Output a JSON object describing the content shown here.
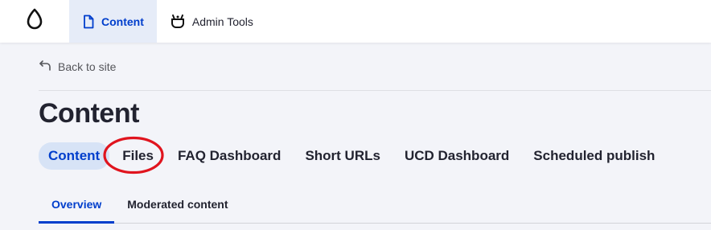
{
  "toolbar": {
    "logo_icon": "drupal-drop-icon",
    "items": [
      {
        "label": "Content",
        "icon": "document-icon",
        "active": true
      },
      {
        "label": "Admin Tools",
        "icon": "admin-tools-icon",
        "active": false
      }
    ]
  },
  "back_link": {
    "label": "Back to site",
    "icon": "back-arrow-icon"
  },
  "page_title": "Content",
  "primary_tabs": [
    {
      "label": "Content",
      "active": true
    },
    {
      "label": "Files",
      "active": false,
      "annotated": true
    },
    {
      "label": "FAQ Dashboard",
      "active": false
    },
    {
      "label": "Short URLs",
      "active": false
    },
    {
      "label": "UCD Dashboard",
      "active": false
    },
    {
      "label": "Scheduled publish",
      "active": false
    }
  ],
  "secondary_tabs": [
    {
      "label": "Overview",
      "active": true
    },
    {
      "label": "Moderated content",
      "active": false
    }
  ],
  "colors": {
    "accent": "#003ecc",
    "annotation": "#e0141e",
    "page_bg": "#f3f4f9"
  }
}
